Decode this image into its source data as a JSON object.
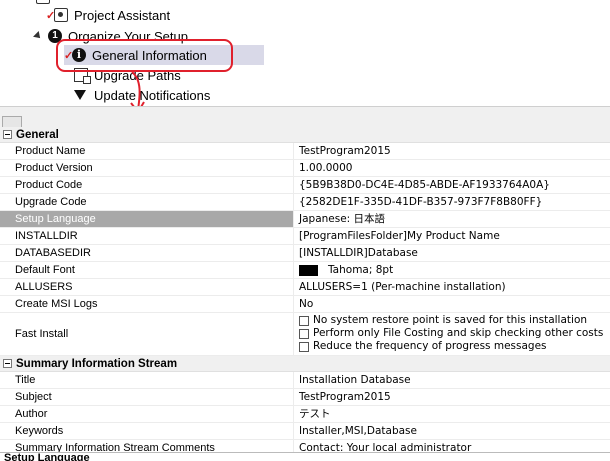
{
  "tree": {
    "items": [
      {
        "label": "Project Assistant",
        "checked": true,
        "icon": "project-assistant-icon"
      },
      {
        "label": "Organize Your Setup",
        "icon": "step-1-icon",
        "step": "1"
      },
      {
        "label": "General Information",
        "checked": true,
        "icon": "info-icon",
        "selected": true
      },
      {
        "label": "Upgrade Paths",
        "icon": "upgrade-paths-icon"
      },
      {
        "label": "Update Notifications",
        "icon": "funnel-icon"
      }
    ],
    "check_glyph": "✓"
  },
  "annotation": {
    "color": "#e0202c"
  },
  "grid": {
    "general": {
      "title": "General",
      "rows": [
        {
          "name": "Product Name",
          "value": "TestProgram2015"
        },
        {
          "name": "Product Version",
          "value": "1.00.0000"
        },
        {
          "name": "Product Code",
          "value": "{5B9B38D0-DC4E-4D85-ABDE-AF1933764A0A}"
        },
        {
          "name": "Upgrade Code",
          "value": "{2582DE1F-335D-41DF-B357-973F7F8B80FF}"
        },
        {
          "name": "Setup Language",
          "value": "Japanese: 日本語",
          "selected": true
        },
        {
          "name": "INSTALLDIR",
          "value": "[ProgramFilesFolder]My Product Name"
        },
        {
          "name": "DATABASEDIR",
          "value": "[INSTALLDIR]Database"
        },
        {
          "name": "Default Font",
          "value": "Tahoma; 8pt"
        },
        {
          "name": "ALLUSERS",
          "value": "ALLUSERS=1 (Per-machine installation)"
        },
        {
          "name": "Create MSI Logs",
          "value": "No"
        }
      ],
      "fast_install": {
        "name": "Fast Install",
        "options": [
          "No system restore point is saved for this installation",
          "Perform only File Costing and skip checking other costs",
          "Reduce the frequency of progress messages"
        ]
      }
    },
    "summary": {
      "title": "Summary Information Stream",
      "rows": [
        {
          "name": "Title",
          "value": "Installation Database"
        },
        {
          "name": "Subject",
          "value": "TestProgram2015"
        },
        {
          "name": "Author",
          "value": "テスト"
        },
        {
          "name": "Keywords",
          "value": "Installer,MSI,Database"
        },
        {
          "name": "Summary Information Stream Comments",
          "value": "Contact:  Your local administrator"
        }
      ]
    }
  },
  "description": {
    "title": "Setup Language"
  }
}
